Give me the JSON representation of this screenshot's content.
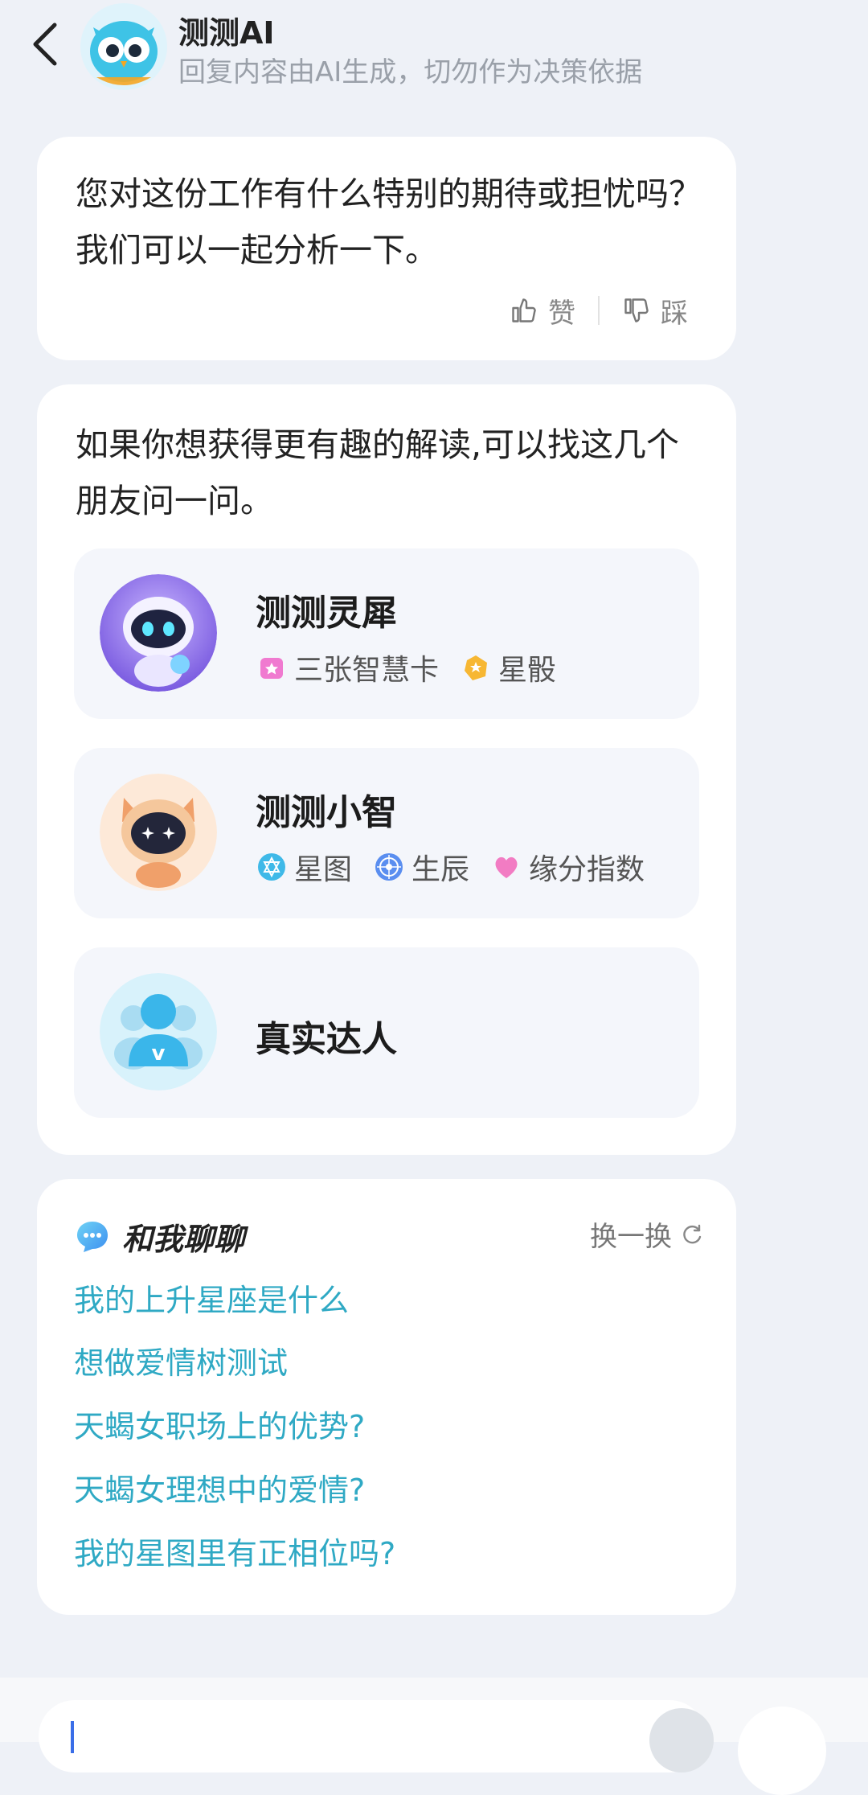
{
  "header": {
    "title": "测测AI",
    "subtitle": "回复内容由AI生成，切勿作为决策依据"
  },
  "message": {
    "text": "您对这份工作有什么特别的期待或担忧吗？我们可以一起分析一下。",
    "like_label": "赞",
    "dislike_label": "踩"
  },
  "friends": {
    "intro": "如果你想获得更有趣的解读,可以找这几个朋友问一问。",
    "items": [
      {
        "name": "测测灵犀",
        "tags": [
          "三张智慧卡",
          "星骰"
        ]
      },
      {
        "name": "测测小智",
        "tags": [
          "星图",
          "生辰",
          "缘分指数"
        ]
      },
      {
        "name": "真实达人",
        "tags": []
      }
    ]
  },
  "chat": {
    "title": "和我聊聊",
    "refresh_label": "换一换",
    "suggestions": [
      "我的上升星座是什么",
      "想做爱情树测试",
      "天蝎女职场上的优势?",
      "天蝎女理想中的爱情?",
      "我的星图里有正相位吗?"
    ]
  },
  "colors": {
    "background": "#eef1f7",
    "suggestion_link": "#2fa9c4",
    "accent": "#3a6ee8"
  }
}
